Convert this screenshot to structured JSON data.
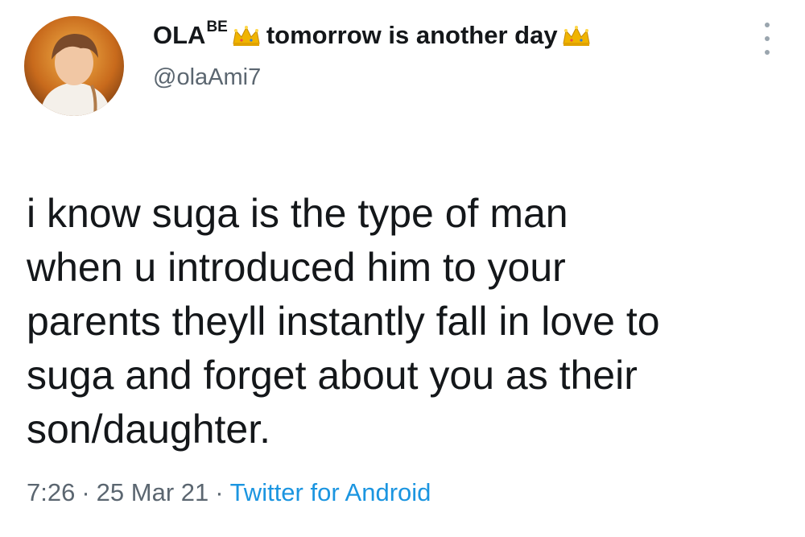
{
  "author": {
    "name": "OLA",
    "name_superscript": "BE",
    "name_tail": "tomorrow is another day",
    "handle": "@olaAmi7",
    "crown_icon": "crown-icon"
  },
  "tweet": {
    "lines": [
      "i know suga is the type of man",
      "when u introduced him to your",
      "parents theyll instantly fall in love to",
      "suga and forget about you as their",
      "son/daughter."
    ]
  },
  "meta": {
    "time": "7:26",
    "separator": "·",
    "date": "25 Mar 21",
    "source": "Twitter for Android"
  },
  "colors": {
    "text": "#14171a",
    "secondary": "#5b6670",
    "link": "#1b95e0",
    "crown": "#f0b400"
  }
}
